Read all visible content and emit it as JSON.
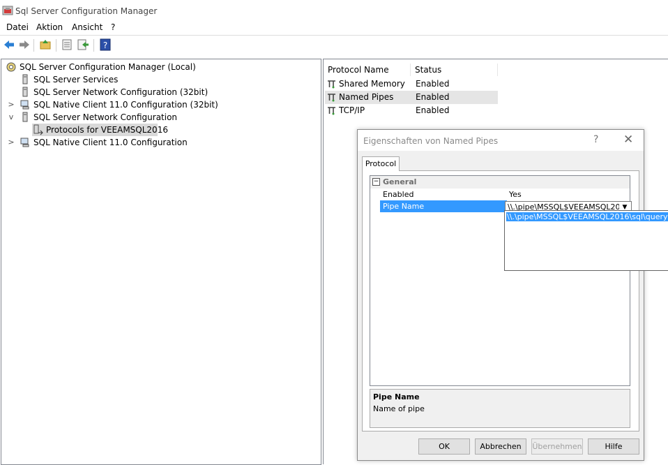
{
  "window": {
    "title": "Sql Server Configuration Manager"
  },
  "menu": {
    "items": [
      "Datei",
      "Aktion",
      "Ansicht",
      "?"
    ]
  },
  "toolbar": {
    "buttons": [
      "back-icon",
      "forward-icon",
      "up-folder-icon",
      "properties-icon",
      "export-icon",
      "help-icon"
    ]
  },
  "tree": {
    "items": [
      {
        "label": "SQL Server Configuration Manager (Local)"
      },
      {
        "label": "SQL Server Services"
      },
      {
        "label": "SQL Server Network Configuration (32bit)"
      },
      {
        "label": "SQL Native Client 11.0 Configuration (32bit)"
      },
      {
        "label": "SQL Server Network Configuration"
      },
      {
        "label": "Protocols for VEEAMSQL2016"
      },
      {
        "label": "SQL Native Client 11.0 Configuration"
      }
    ]
  },
  "protocols": {
    "columns": [
      "Protocol Name",
      "Status"
    ],
    "rows": [
      {
        "name": "Shared Memory",
        "status": "Enabled"
      },
      {
        "name": "Named Pipes",
        "status": "Enabled"
      },
      {
        "name": "TCP/IP",
        "status": "Enabled"
      }
    ]
  },
  "dialog": {
    "title": "Eigenschaften von Named Pipes",
    "help": "?",
    "close": "✕",
    "tab": "Protocol",
    "category": "General",
    "expander": "−",
    "properties": [
      {
        "key": "Enabled",
        "value": "Yes"
      },
      {
        "key": "Pipe Name",
        "value": "\\\\.\\pipe\\MSSQL$VEEAMSQL2016\\sql\\query"
      }
    ],
    "dropdown_option": "\\\\.\\pipe\\MSSQL$VEEAMSQL2016\\sql\\query",
    "description": {
      "title": "Pipe Name",
      "text": "Name of pipe"
    },
    "buttons": {
      "ok": "OK",
      "cancel": "Abbrechen",
      "apply": "Übernehmen",
      "help": "Hilfe"
    }
  },
  "colors": {
    "selection": "#3399ff",
    "dialog_bg": "#f0f0f0",
    "title_text": "#8a8a8a"
  }
}
